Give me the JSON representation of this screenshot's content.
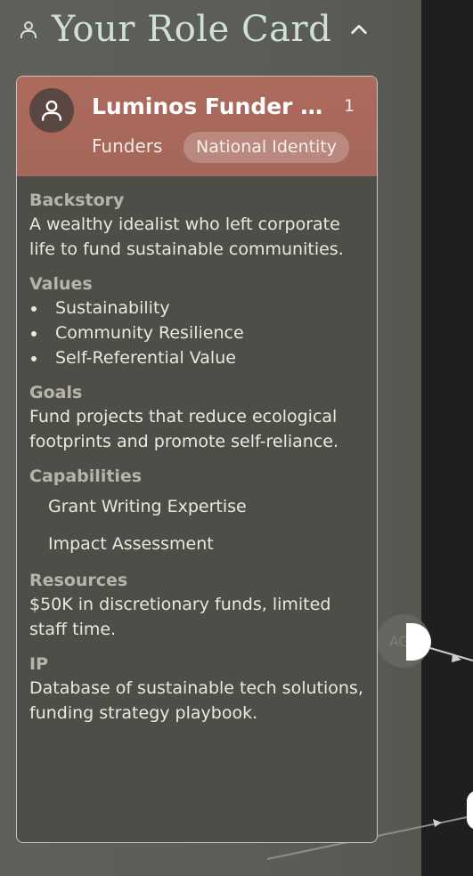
{
  "header": {
    "title": "Your Role Card",
    "icon": "person-icon",
    "toggle_icon": "chevron-up-icon"
  },
  "card": {
    "name": "Luminos Funder Network",
    "count": "1",
    "group": "Funders",
    "badge": "National Identity",
    "header_color": "#a96a5c",
    "sections": {
      "backstory": {
        "title": "Backstory",
        "text": "A wealthy idealist who left corporate life to fund sustainable communities."
      },
      "values": {
        "title": "Values",
        "items": [
          "Sustainability",
          "Community Resilience",
          "Self-Referential Value"
        ]
      },
      "goals": {
        "title": "Goals",
        "text": "Fund projects that reduce ecological footprints and promote self-reliance."
      },
      "capabilities": {
        "title": "Capabilities",
        "items": [
          "Grant Writing Expertise",
          "Impact Assessment"
        ]
      },
      "resources": {
        "title": "Resources",
        "text": "$50K in discretionary funds, limited staff time."
      },
      "ip": {
        "title": "IP",
        "text": "Database of sustainable tech solutions, funding strategy playbook."
      }
    }
  },
  "graph": {
    "node_label": "AGT"
  }
}
